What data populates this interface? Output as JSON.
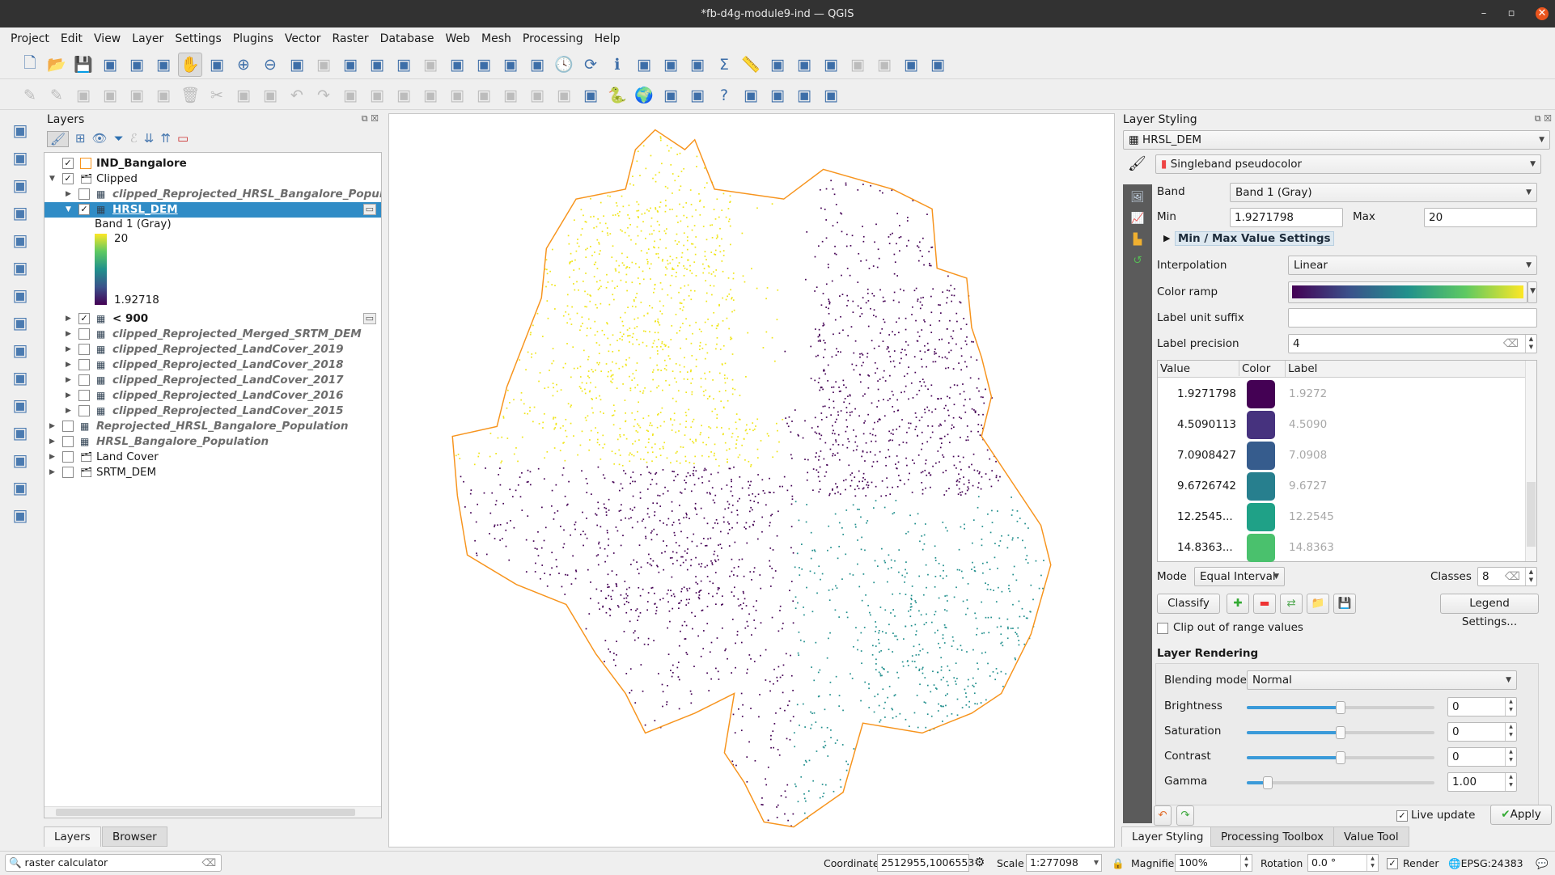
{
  "window": {
    "title": "*fb-d4g-module9-ind — QGIS",
    "min": "–",
    "max": "▫",
    "close": "✕"
  },
  "menu": [
    "Project",
    "Edit",
    "View",
    "Layer",
    "Settings",
    "Plugins",
    "Vector",
    "Raster",
    "Database",
    "Web",
    "Mesh",
    "Processing",
    "Help"
  ],
  "toolbar1": [
    "new-project",
    "open-project",
    "save-project",
    "new-print-layout",
    "layout-manager",
    "style-manager",
    "pan",
    "pan-to-selection",
    "zoom-in",
    "zoom-out",
    "zoom-full",
    "zoom-to-selection",
    "zoom-to-layer",
    "zoom-native",
    "zoom-last",
    "zoom-next",
    "new-bookmark",
    "show-bookmarks",
    "new-spatial-bookmark",
    "show-spatial-bookmarks",
    "temporal-controller",
    "refresh",
    "identify",
    "attribute-table",
    "field-calculator",
    "processing-toolbox",
    "statistics",
    "measure",
    "map-tips",
    "select-feature",
    "text-annotation",
    "select-location",
    "deselect",
    "add-feature",
    "annotation"
  ],
  "toolbar2": [
    "current-edits",
    "toggle-editing",
    "save-edits",
    "digitize",
    "vertex-tool",
    "modify-attributes",
    "delete-selected",
    "cut-features",
    "copy-features",
    "paste-features",
    "undo",
    "redo",
    "label-tool",
    "diagram-tool",
    "layer-labeling",
    "rule-labeling",
    "pin-labels",
    "show-hide-labels",
    "move-label",
    "rotate-label",
    "change-label",
    "osm-plugin",
    "python-console",
    "globe",
    "metasearch",
    "georeferencer",
    "help",
    "qgis2web",
    "quickmapservices",
    "qgis-cloud",
    "custom-plugin"
  ],
  "vtoolbar": [
    "data-source-manager",
    "new-geopackage",
    "add-vector",
    "add-delimited",
    "add-spatialite",
    "add-virtual",
    "new-shapefile",
    "add-raster",
    "add-mesh",
    "add-wms",
    "add-wfs",
    "add-wcs",
    "add-xyz",
    "add-postgis",
    "add-vector-tile"
  ],
  "layers_panel": {
    "title": "Layers",
    "rows": [
      {
        "label": "IND_Bangalore",
        "level": 0,
        "checked": true,
        "style": "bold",
        "icon": "polygon-icon",
        "expander": ""
      },
      {
        "label": "Clipped",
        "level": 0,
        "checked": true,
        "style": "normal",
        "icon": "group-icon",
        "expander": "open"
      },
      {
        "label": "clipped_Reprojected_HRSL_Bangalore_Popula",
        "level": 1,
        "checked": false,
        "style": "italic",
        "icon": "raster-icon",
        "expander": "closed"
      },
      {
        "label": "HRSL_DEM",
        "level": 1,
        "checked": true,
        "style": "bold",
        "icon": "raster-icon",
        "expander": "open",
        "selected": true
      }
    ],
    "legend": {
      "band": "Band 1 (Gray)",
      "max": "20",
      "min": "1.92718"
    },
    "rows2": [
      {
        "label": "< 900",
        "level": 1,
        "checked": true,
        "style": "bold",
        "icon": "raster-icon",
        "expander": "closed"
      },
      {
        "label": "clipped_Reprojected_Merged_SRTM_DEM",
        "level": 1,
        "checked": false,
        "style": "italic",
        "icon": "raster-icon",
        "expander": "closed"
      },
      {
        "label": "clipped_Reprojected_LandCover_2019",
        "level": 1,
        "checked": false,
        "style": "italic",
        "icon": "raster-icon",
        "expander": "closed"
      },
      {
        "label": "clipped_Reprojected_LandCover_2018",
        "level": 1,
        "checked": false,
        "style": "italic",
        "icon": "raster-icon",
        "expander": "closed"
      },
      {
        "label": "clipped_Reprojected_LandCover_2017",
        "level": 1,
        "checked": false,
        "style": "italic",
        "icon": "raster-icon",
        "expander": "closed"
      },
      {
        "label": "clipped_Reprojected_LandCover_2016",
        "level": 1,
        "checked": false,
        "style": "italic",
        "icon": "raster-icon",
        "expander": "closed"
      },
      {
        "label": "clipped_Reprojected_LandCover_2015",
        "level": 1,
        "checked": false,
        "style": "italic",
        "icon": "raster-icon",
        "expander": "closed"
      },
      {
        "label": "Reprojected_HRSL_Bangalore_Population",
        "level": 0,
        "checked": false,
        "style": "italic",
        "icon": "raster-icon",
        "expander": "closed"
      },
      {
        "label": "HRSL_Bangalore_Population",
        "level": 0,
        "checked": false,
        "style": "italic",
        "icon": "raster-icon",
        "expander": "closed"
      },
      {
        "label": "Land Cover",
        "level": 0,
        "checked": false,
        "style": "normal",
        "icon": "group-icon",
        "expander": "closed"
      },
      {
        "label": "SRTM_DEM",
        "level": 0,
        "checked": false,
        "style": "normal",
        "icon": "group-icon",
        "expander": "closed"
      }
    ],
    "tabs": [
      "Layers",
      "Browser"
    ]
  },
  "map": {
    "boundary_color": "#f7941d",
    "class_colors": {
      "yellow": "#f0e51a",
      "purple": "#440154",
      "teal": "#218f8d"
    }
  },
  "styling": {
    "title": "Layer Styling",
    "layer": "HRSL_DEM",
    "renderer": "Singleband pseudocolor",
    "band_label": "Band",
    "band": "Band 1 (Gray)",
    "min_label": "Min",
    "min": "1.9271798",
    "max_label": "Max",
    "max": "20",
    "minmax_settings": "Min / Max Value Settings",
    "interp_label": "Interpolation",
    "interp": "Linear",
    "ramp_label": "Color ramp",
    "ramp_colors": [
      "#440154",
      "#3b528b",
      "#21918c",
      "#5ec962",
      "#fde725"
    ],
    "suffix_label": "Label unit suffix",
    "suffix": "",
    "precision_label": "Label precision",
    "precision": "4",
    "table_headers": [
      "Value",
      "Color",
      "Label"
    ],
    "classes_table": [
      {
        "value": "1.9271798",
        "color": "#440154",
        "label": "1.9272"
      },
      {
        "value": "4.5090113",
        "color": "#46327e",
        "label": "4.5090"
      },
      {
        "value": "7.0908427",
        "color": "#365c8d",
        "label": "7.0908"
      },
      {
        "value": "9.6726742",
        "color": "#277f8e",
        "label": "9.6727"
      },
      {
        "value": "12.2545...",
        "color": "#1fa187",
        "label": "12.2545"
      },
      {
        "value": "14.8363...",
        "color": "#4ac16d",
        "label": "14.8363"
      }
    ],
    "mode_label": "Mode",
    "mode": "Equal Interval",
    "classes_label": "Classes",
    "classes": "8",
    "classify": "Classify",
    "legend_settings": "Legend Settings...",
    "clip_label": "Clip out of range values",
    "clip": false,
    "rendering_title": "Layer Rendering",
    "blend_label": "Blending mode",
    "blend": "Normal",
    "sliders": [
      {
        "label": "Brightness",
        "value": "0",
        "fraction": 0.5
      },
      {
        "label": "Saturation",
        "value": "0",
        "fraction": 0.5
      },
      {
        "label": "Contrast",
        "value": "0",
        "fraction": 0.5
      },
      {
        "label": "Gamma",
        "value": "1.00",
        "fraction": 0.11
      }
    ],
    "live_update": "Live update",
    "live": true,
    "apply": "Apply",
    "tabs": [
      "Layer Styling",
      "Processing Toolbox",
      "Value Tool"
    ]
  },
  "status": {
    "search": "raster calculator",
    "coord_label": "Coordinate",
    "coord": "2512955,1006553",
    "scale_label": "Scale",
    "scale": "1:277098",
    "mag_label": "Magnifier",
    "mag": "100%",
    "rot_label": "Rotation",
    "rot": "0.0 °",
    "render": "Render",
    "crs": "EPSG:24383"
  }
}
